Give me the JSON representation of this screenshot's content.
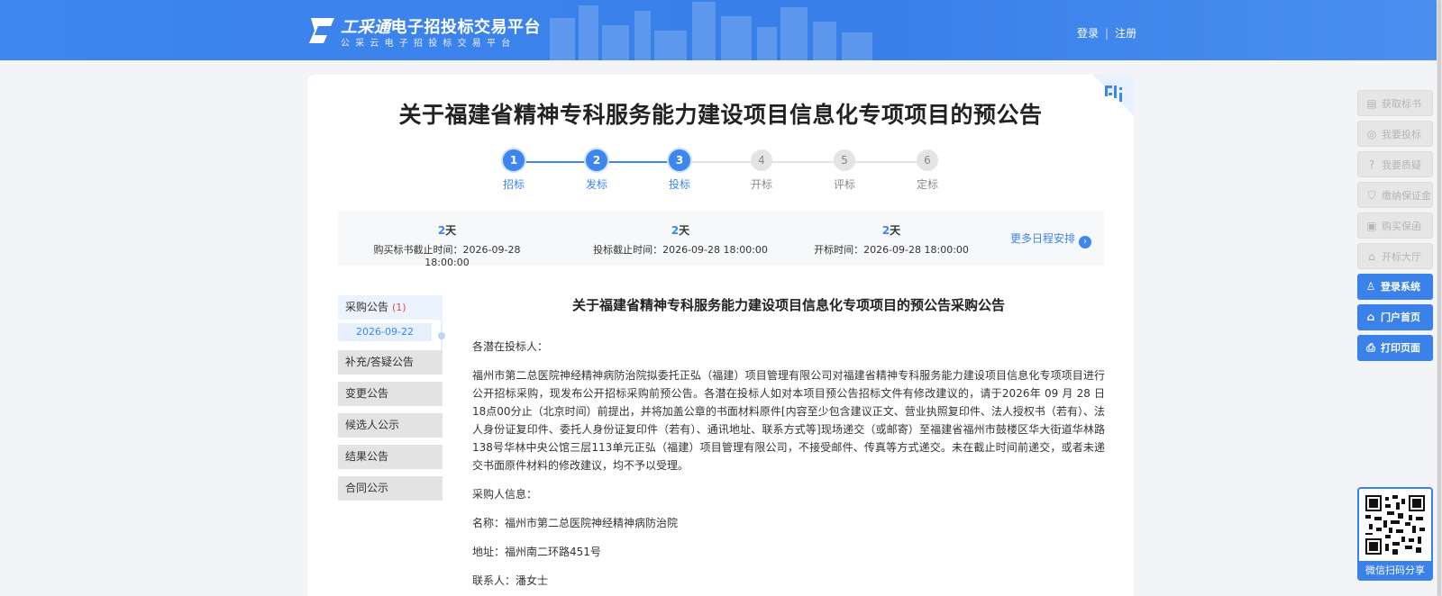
{
  "header": {
    "logo_brand": "工采通",
    "logo_title": "电子招投标交易平台",
    "logo_subtitle": "公采云电子招投标交易平台",
    "login": "登录",
    "separator": "|",
    "register": "注册"
  },
  "page": {
    "title": "关于福建省精神专科服务能力建设项目信息化专项项目的预公告"
  },
  "steps": [
    {
      "num": "1",
      "label": "招标",
      "state": "done"
    },
    {
      "num": "2",
      "label": "发标",
      "state": "done"
    },
    {
      "num": "3",
      "label": "投标",
      "state": "done"
    },
    {
      "num": "4",
      "label": "开标",
      "state": "todo"
    },
    {
      "num": "5",
      "label": "评标",
      "state": "todo"
    },
    {
      "num": "6",
      "label": "定标",
      "state": "todo"
    }
  ],
  "schedule": {
    "items": [
      {
        "days_num": "2",
        "days_unit": "天",
        "label": "购买标书截止时间：",
        "time": "2026-09-28 18:00:00"
      },
      {
        "days_num": "2",
        "days_unit": "天",
        "label": "投标截止时间：",
        "time": "2026-09-28 18:00:00"
      },
      {
        "days_num": "2",
        "days_unit": "天",
        "label": "开标时间：",
        "time": "2026-09-28 18:00:00"
      }
    ],
    "more": "更多日程安排"
  },
  "left_nav": {
    "active": {
      "label": "采购公告",
      "count": "(1)",
      "date": "2026-09-22"
    },
    "items": [
      "补充/答疑公告",
      "变更公告",
      "候选人公示",
      "结果公告",
      "合同公示"
    ]
  },
  "article": {
    "title": "关于福建省精神专科服务能力建设项目信息化专项项目的预公告采购公告",
    "greeting": "各潜在投标人：",
    "body": "福州市第二总医院神经精神病防治院拟委托正弘（福建）项目管理有限公司对福建省精神专科服务能力建设项目信息化专项项目进行公开招标采购，现发布公开招标采购前预公告。各潜在投标人如对本项目预公告招标文件有修改建议的，请于2026年 09 月 28 日18点00分止（北京时间）前提出，并将加盖公章的书面材料原件[内容至少包含建议正文、营业执照复印件、法人授权书（若有）、法人身份证复印件、委托人身份证复印件（若有）、通讯地址、联系方式等]现场递交（或邮寄）至福建省福州市鼓楼区华大街道华林路138号华林中央公馆三层113单元正弘（福建）项目管理有限公司，不接受邮件、传真等方式递交。未在截止时间前递交，或者未递交书面原件材料的修改建议，均不予以受理。",
    "purchaser_heading": "采购人信息：",
    "name": "名称：福州市第二总医院神经精神病防治院",
    "address": "地址：福州南二环路451号",
    "contact": "联系人：潘女士"
  },
  "right_toolbar": {
    "buttons": [
      {
        "label": "获取标书",
        "icon": "document-icon",
        "enabled": false
      },
      {
        "label": "我要投标",
        "icon": "target-icon",
        "enabled": false
      },
      {
        "label": "我要质疑",
        "icon": "question-icon",
        "enabled": false
      },
      {
        "label": "缴纳保证金",
        "icon": "shield-icon",
        "enabled": false
      },
      {
        "label": "购买保函",
        "icon": "printer-doc-icon",
        "enabled": false
      },
      {
        "label": "开标大厅",
        "icon": "bank-icon",
        "enabled": false
      },
      {
        "label": "登录系统",
        "icon": "user-icon",
        "enabled": true
      },
      {
        "label": "门户首页",
        "icon": "home-icon",
        "enabled": true
      },
      {
        "label": "打印页面",
        "icon": "print-icon",
        "enabled": true
      }
    ],
    "qr_caption": "微信扫码分享"
  },
  "colors": {
    "primary": "#3d86ee",
    "count_red": "#e04a3f"
  }
}
